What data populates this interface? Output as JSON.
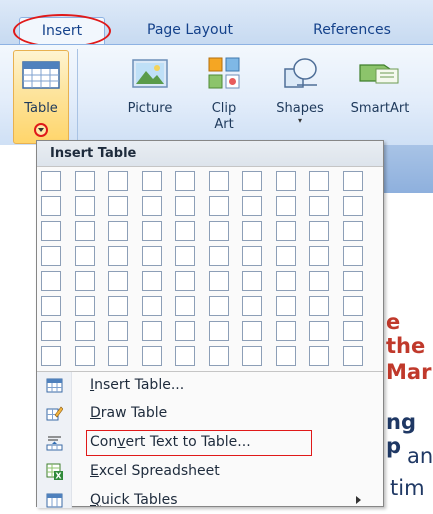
{
  "ribbon": {
    "tabs": [
      {
        "label": "Insert"
      },
      {
        "label": "Page Layout"
      },
      {
        "label": "References"
      }
    ],
    "buttons": {
      "table": "Table",
      "picture": "Picture",
      "clip_art_1": "Clip",
      "clip_art_2": "Art",
      "shapes": "Shapes",
      "smartart": "SmartArt"
    }
  },
  "document": {
    "fragments": [
      "e the",
      "Mar",
      "ng p",
      "an",
      "tim"
    ]
  },
  "dropdown": {
    "header": "Insert Table",
    "grid": {
      "columns": 10,
      "rows": 8
    },
    "items": [
      {
        "pre": "",
        "ul": "I",
        "post": "nsert Table..."
      },
      {
        "pre": "",
        "ul": "D",
        "post": "raw Table"
      },
      {
        "pre": "Con",
        "ul": "v",
        "post": "ert Text to Table..."
      },
      {
        "pre": "",
        "ul": "E",
        "post": "xcel Spreadsheet"
      },
      {
        "pre": "",
        "ul": "Q",
        "post": "uick Tables"
      }
    ]
  },
  "colors": {
    "accent_red": "#e01919",
    "doc_red": "#c0392b",
    "doc_blue": "#1f3864"
  }
}
